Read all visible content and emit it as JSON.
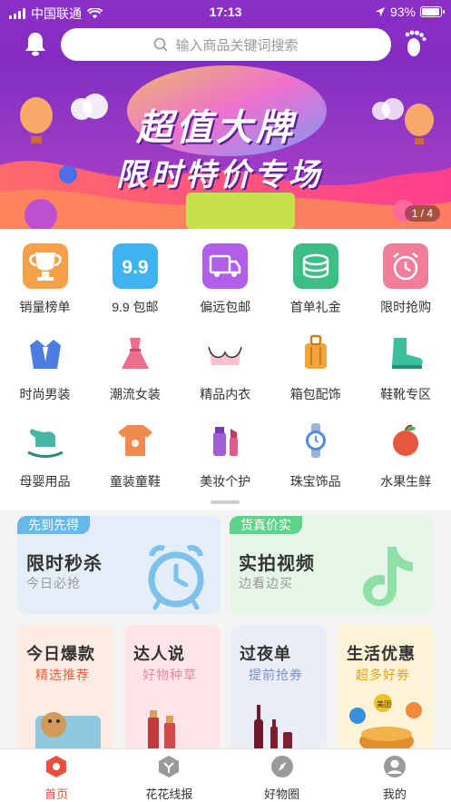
{
  "status": {
    "carrier": "中国联通",
    "time": "17:13",
    "battery": "93%",
    "battery_level": 0.93
  },
  "search": {
    "placeholder": "输入商品关键词搜索"
  },
  "banner": {
    "title1": "超值大牌",
    "title2": "限时特价专场",
    "pager": "1 / 4"
  },
  "categories": [
    {
      "label": "销量榜单",
      "icon": "trophy-icon",
      "color": "#f5a14a"
    },
    {
      "label": "9.9 包邮",
      "icon": "nine-nine-icon",
      "color": "#3fb2f0"
    },
    {
      "label": "偏远包邮",
      "icon": "truck-icon",
      "color": "#b15ee8"
    },
    {
      "label": "首单礼金",
      "icon": "coins-icon",
      "color": "#3dbe84"
    },
    {
      "label": "限时抢购",
      "icon": "alarm-clock-icon",
      "color": "#f07d9a"
    },
    {
      "label": "时尚男装",
      "icon": "suit-icon",
      "color": "#4c7de0"
    },
    {
      "label": "潮流女装",
      "icon": "dress-icon",
      "color": "#ec6d8e"
    },
    {
      "label": "精品内衣",
      "icon": "bra-icon",
      "color": "#ea7b9a"
    },
    {
      "label": "箱包配饰",
      "icon": "luggage-icon",
      "color": "#f2a53a"
    },
    {
      "label": "鞋靴专区",
      "icon": "boot-icon",
      "color": "#3cbf9f"
    },
    {
      "label": "母婴用品",
      "icon": "rocking-horse-icon",
      "color": "#46b9a6"
    },
    {
      "label": "童装童鞋",
      "icon": "baby-clothes-icon",
      "color": "#f08a4f"
    },
    {
      "label": "美妆个护",
      "icon": "cosmetics-icon",
      "color": "#a060d6"
    },
    {
      "label": "珠宝饰品",
      "icon": "watch-icon",
      "color": "#4b8de6"
    },
    {
      "label": "水果生鲜",
      "icon": "apple-icon",
      "color": "#e8563f"
    }
  ],
  "promos": {
    "left": {
      "tag": "先到先得",
      "title": "限时秒杀",
      "subtitle": "今日必抢",
      "tag_color": "#66b8ea",
      "bg": "#e4eef8"
    },
    "right": {
      "tag": "货真价实",
      "title": "实拍视频",
      "subtitle": "边看边买",
      "tag_color": "#5fd38a",
      "bg": "#e5f6e8"
    }
  },
  "cards": [
    {
      "title": "今日爆款",
      "subtitle": "精选推荐",
      "sub_color": "#e8623c",
      "bg": "#fcece3"
    },
    {
      "title": "达人说",
      "subtitle": "好物种草",
      "sub_color": "#ee8aa0",
      "bg": "#fde5ea"
    },
    {
      "title": "过夜单",
      "subtitle": "提前抢券",
      "sub_color": "#7b8fcc",
      "bg": "#ebeef8"
    },
    {
      "title": "生活优惠",
      "subtitle": "超多好券",
      "sub_color": "#e3a21a",
      "bg": "#fdf3d6",
      "logo_text": "美团"
    }
  ],
  "tabs": [
    {
      "label": "首页",
      "icon": "home-icon"
    },
    {
      "label": "花花线报",
      "icon": "flower-icon"
    },
    {
      "label": "好物圈",
      "icon": "compass-icon"
    },
    {
      "label": "我的",
      "icon": "profile-icon"
    }
  ]
}
